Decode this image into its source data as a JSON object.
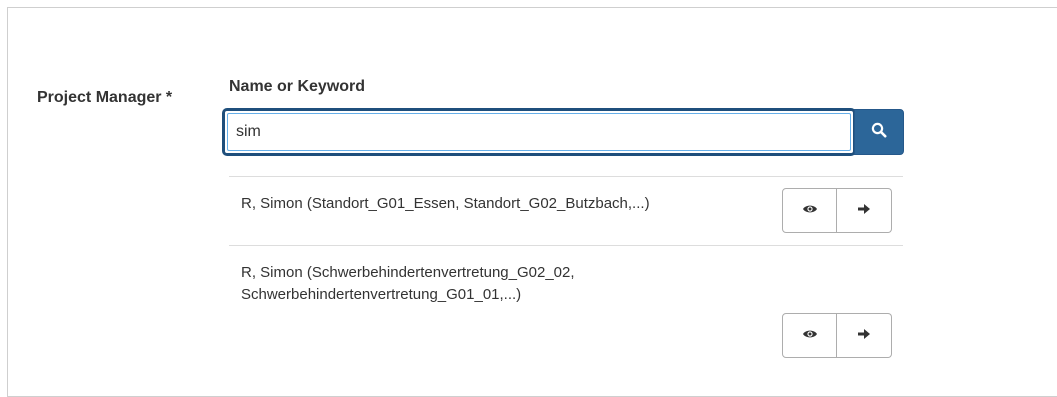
{
  "form": {
    "field_label": "Project Manager *",
    "sub_label": "Name or Keyword",
    "search_value": "sim"
  },
  "results": [
    {
      "text": "R, Simon (Standort_G01_Essen, Standort_G02_Butzbach,...)"
    },
    {
      "text": "R, Simon (Schwerbehindertenvertretung_G02_02, Schwerbehindertenvertretung_G01_01,...)"
    }
  ],
  "icons": {
    "search": "search-icon",
    "view": "eye-icon",
    "select": "arrow-right-icon"
  },
  "colors": {
    "accent": "#2c6699",
    "focus_border": "#1f4f7c"
  }
}
